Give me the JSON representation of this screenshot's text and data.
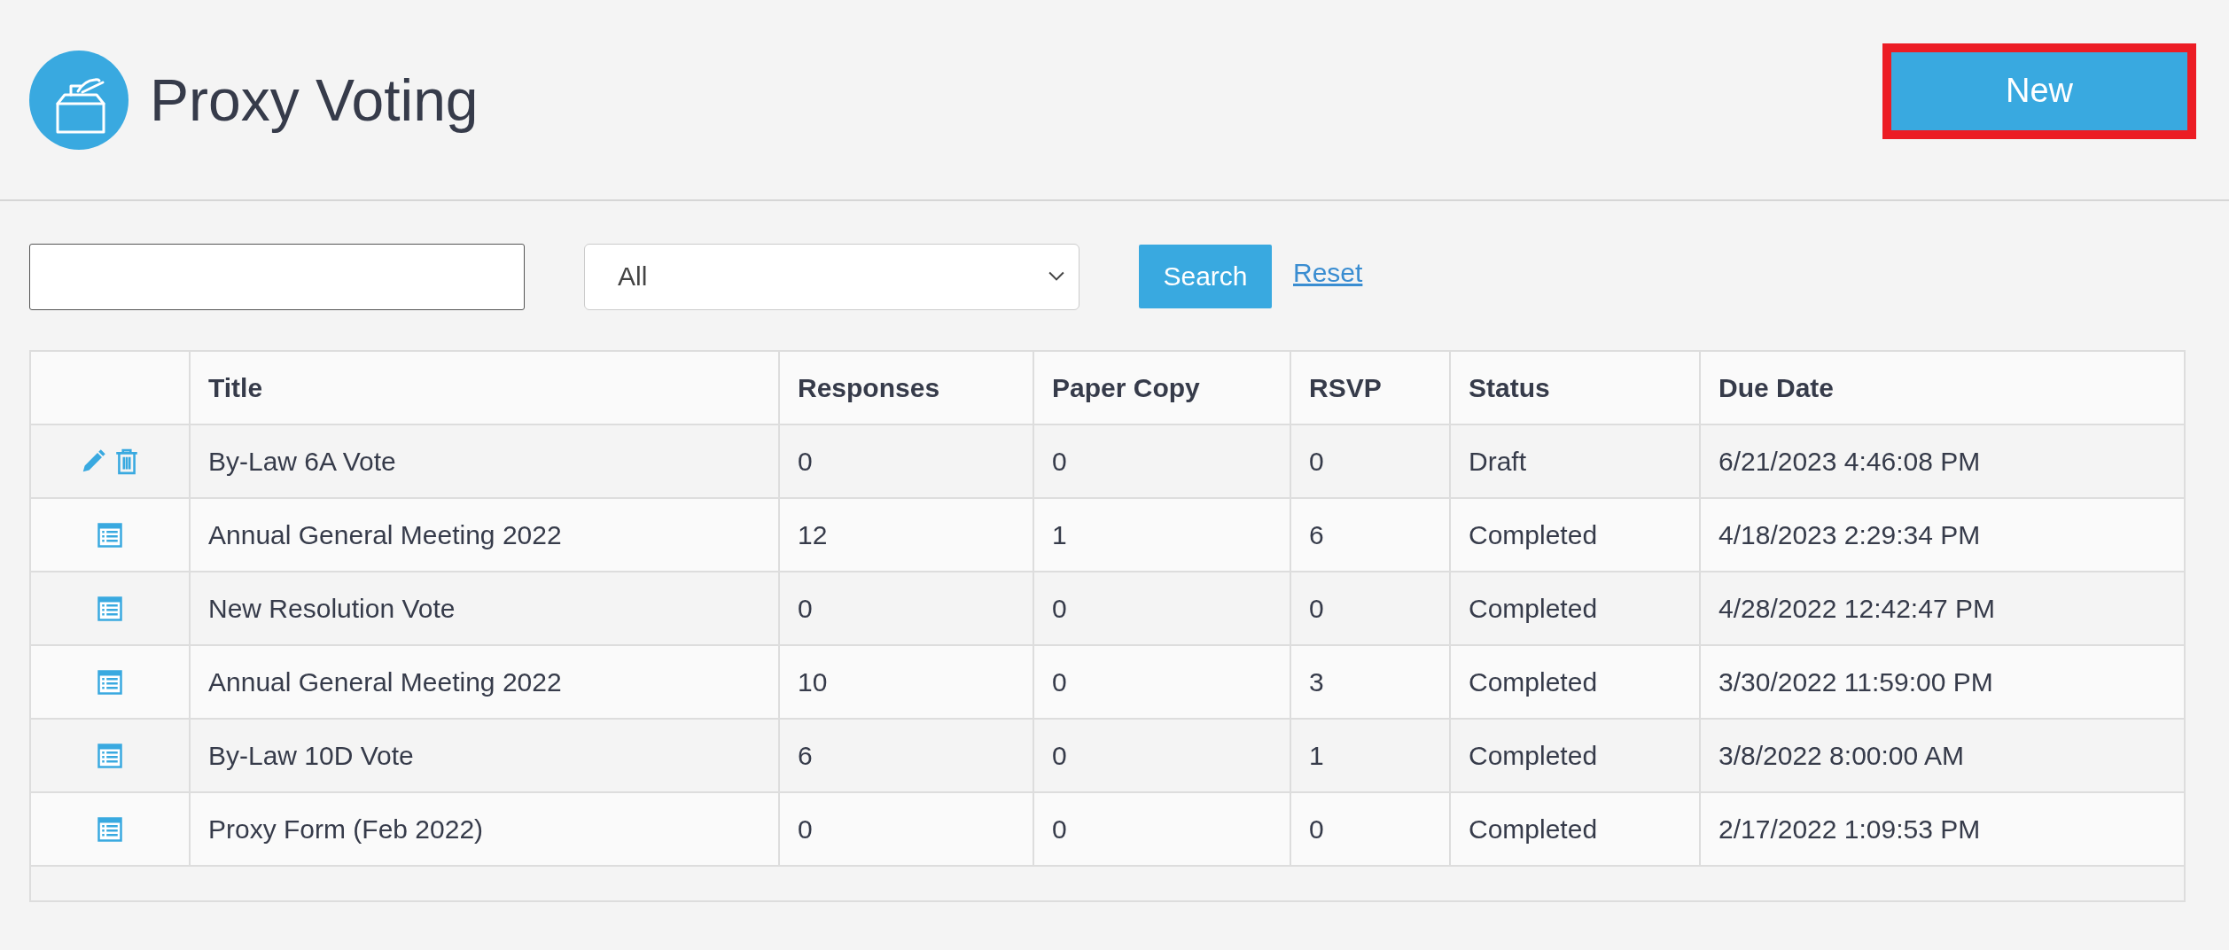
{
  "header": {
    "title": "Proxy Voting",
    "new_button": {
      "label": "New",
      "highlighted": true
    }
  },
  "filters": {
    "status_select": "All",
    "search_button": "Search",
    "reset_link": "Reset"
  },
  "table": {
    "columns": [
      "Title",
      "Responses",
      "Paper Copy",
      "RSVP",
      "Status",
      "Due Date"
    ],
    "rows": [
      {
        "kind": "editable",
        "cells": [
          "By-Law 6A Vote",
          "0",
          "0",
          "0",
          "Draft",
          "6/21/2023 4:46:08 PM"
        ]
      },
      {
        "kind": "report",
        "cells": [
          "Annual General Meeting 2022",
          "12",
          "1",
          "6",
          "Completed",
          "4/18/2023 2:29:34 PM"
        ]
      },
      {
        "kind": "report",
        "cells": [
          "New Resolution Vote",
          "0",
          "0",
          "0",
          "Completed",
          "4/28/2022 12:42:47 PM"
        ]
      },
      {
        "kind": "report",
        "cells": [
          "Annual General Meeting 2022",
          "10",
          "0",
          "3",
          "Completed",
          "3/30/2022 11:59:00 PM"
        ]
      },
      {
        "kind": "report",
        "cells": [
          "By-Law 10D Vote",
          "6",
          "0",
          "1",
          "Completed",
          "3/8/2022 8:00:00 AM"
        ]
      },
      {
        "kind": "report",
        "cells": [
          "Proxy Form (Feb 2022)",
          "0",
          "0",
          "0",
          "Completed",
          "2/17/2022 1:09:53 PM"
        ]
      }
    ]
  }
}
